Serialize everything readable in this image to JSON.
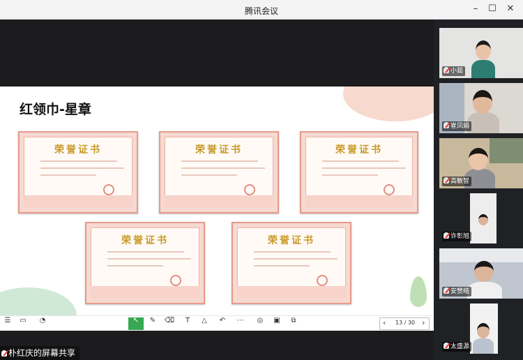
{
  "window": {
    "title": "腾讯会议",
    "minimize": "–",
    "maximize": "☐",
    "close": "✕"
  },
  "slide": {
    "title": "红领巾-星章"
  },
  "certificates": [
    {
      "heading": "荣誉证书"
    },
    {
      "heading": "荣誉证书"
    },
    {
      "heading": "荣誉证书"
    },
    {
      "heading": "荣誉证书"
    },
    {
      "heading": "荣誉证书"
    }
  ],
  "toolbar": {
    "page_indicator": "13 / 30",
    "prev": "‹",
    "next": "›"
  },
  "share_status": "朴红庆的屏幕共享",
  "participants": [
    {
      "name": "小茹"
    },
    {
      "name": "崔凤娟"
    },
    {
      "name": "高敏智"
    },
    {
      "name": "许彰旭"
    },
    {
      "name": "安赞皓"
    },
    {
      "name": "太盛源"
    }
  ],
  "colors": {
    "accent": "#36a852",
    "cert_border": "#e79a8c",
    "cert_gold": "#c89a2a"
  }
}
